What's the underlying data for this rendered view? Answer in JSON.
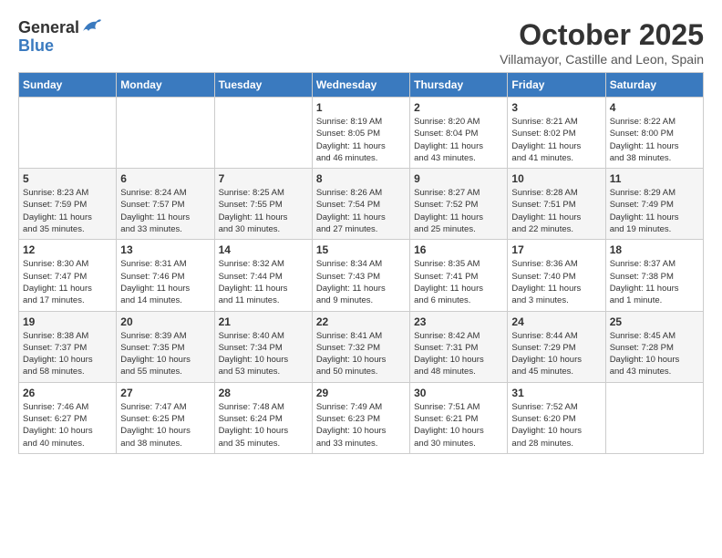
{
  "header": {
    "logo_general": "General",
    "logo_blue": "Blue",
    "month": "October 2025",
    "location": "Villamayor, Castille and Leon, Spain"
  },
  "days_of_week": [
    "Sunday",
    "Monday",
    "Tuesday",
    "Wednesday",
    "Thursday",
    "Friday",
    "Saturday"
  ],
  "weeks": [
    [
      {
        "day": "",
        "info": ""
      },
      {
        "day": "",
        "info": ""
      },
      {
        "day": "",
        "info": ""
      },
      {
        "day": "1",
        "info": "Sunrise: 8:19 AM\nSunset: 8:05 PM\nDaylight: 11 hours\nand 46 minutes."
      },
      {
        "day": "2",
        "info": "Sunrise: 8:20 AM\nSunset: 8:04 PM\nDaylight: 11 hours\nand 43 minutes."
      },
      {
        "day": "3",
        "info": "Sunrise: 8:21 AM\nSunset: 8:02 PM\nDaylight: 11 hours\nand 41 minutes."
      },
      {
        "day": "4",
        "info": "Sunrise: 8:22 AM\nSunset: 8:00 PM\nDaylight: 11 hours\nand 38 minutes."
      }
    ],
    [
      {
        "day": "5",
        "info": "Sunrise: 8:23 AM\nSunset: 7:59 PM\nDaylight: 11 hours\nand 35 minutes."
      },
      {
        "day": "6",
        "info": "Sunrise: 8:24 AM\nSunset: 7:57 PM\nDaylight: 11 hours\nand 33 minutes."
      },
      {
        "day": "7",
        "info": "Sunrise: 8:25 AM\nSunset: 7:55 PM\nDaylight: 11 hours\nand 30 minutes."
      },
      {
        "day": "8",
        "info": "Sunrise: 8:26 AM\nSunset: 7:54 PM\nDaylight: 11 hours\nand 27 minutes."
      },
      {
        "day": "9",
        "info": "Sunrise: 8:27 AM\nSunset: 7:52 PM\nDaylight: 11 hours\nand 25 minutes."
      },
      {
        "day": "10",
        "info": "Sunrise: 8:28 AM\nSunset: 7:51 PM\nDaylight: 11 hours\nand 22 minutes."
      },
      {
        "day": "11",
        "info": "Sunrise: 8:29 AM\nSunset: 7:49 PM\nDaylight: 11 hours\nand 19 minutes."
      }
    ],
    [
      {
        "day": "12",
        "info": "Sunrise: 8:30 AM\nSunset: 7:47 PM\nDaylight: 11 hours\nand 17 minutes."
      },
      {
        "day": "13",
        "info": "Sunrise: 8:31 AM\nSunset: 7:46 PM\nDaylight: 11 hours\nand 14 minutes."
      },
      {
        "day": "14",
        "info": "Sunrise: 8:32 AM\nSunset: 7:44 PM\nDaylight: 11 hours\nand 11 minutes."
      },
      {
        "day": "15",
        "info": "Sunrise: 8:34 AM\nSunset: 7:43 PM\nDaylight: 11 hours\nand 9 minutes."
      },
      {
        "day": "16",
        "info": "Sunrise: 8:35 AM\nSunset: 7:41 PM\nDaylight: 11 hours\nand 6 minutes."
      },
      {
        "day": "17",
        "info": "Sunrise: 8:36 AM\nSunset: 7:40 PM\nDaylight: 11 hours\nand 3 minutes."
      },
      {
        "day": "18",
        "info": "Sunrise: 8:37 AM\nSunset: 7:38 PM\nDaylight: 11 hours\nand 1 minute."
      }
    ],
    [
      {
        "day": "19",
        "info": "Sunrise: 8:38 AM\nSunset: 7:37 PM\nDaylight: 10 hours\nand 58 minutes."
      },
      {
        "day": "20",
        "info": "Sunrise: 8:39 AM\nSunset: 7:35 PM\nDaylight: 10 hours\nand 55 minutes."
      },
      {
        "day": "21",
        "info": "Sunrise: 8:40 AM\nSunset: 7:34 PM\nDaylight: 10 hours\nand 53 minutes."
      },
      {
        "day": "22",
        "info": "Sunrise: 8:41 AM\nSunset: 7:32 PM\nDaylight: 10 hours\nand 50 minutes."
      },
      {
        "day": "23",
        "info": "Sunrise: 8:42 AM\nSunset: 7:31 PM\nDaylight: 10 hours\nand 48 minutes."
      },
      {
        "day": "24",
        "info": "Sunrise: 8:44 AM\nSunset: 7:29 PM\nDaylight: 10 hours\nand 45 minutes."
      },
      {
        "day": "25",
        "info": "Sunrise: 8:45 AM\nSunset: 7:28 PM\nDaylight: 10 hours\nand 43 minutes."
      }
    ],
    [
      {
        "day": "26",
        "info": "Sunrise: 7:46 AM\nSunset: 6:27 PM\nDaylight: 10 hours\nand 40 minutes."
      },
      {
        "day": "27",
        "info": "Sunrise: 7:47 AM\nSunset: 6:25 PM\nDaylight: 10 hours\nand 38 minutes."
      },
      {
        "day": "28",
        "info": "Sunrise: 7:48 AM\nSunset: 6:24 PM\nDaylight: 10 hours\nand 35 minutes."
      },
      {
        "day": "29",
        "info": "Sunrise: 7:49 AM\nSunset: 6:23 PM\nDaylight: 10 hours\nand 33 minutes."
      },
      {
        "day": "30",
        "info": "Sunrise: 7:51 AM\nSunset: 6:21 PM\nDaylight: 10 hours\nand 30 minutes."
      },
      {
        "day": "31",
        "info": "Sunrise: 7:52 AM\nSunset: 6:20 PM\nDaylight: 10 hours\nand 28 minutes."
      },
      {
        "day": "",
        "info": ""
      }
    ]
  ]
}
